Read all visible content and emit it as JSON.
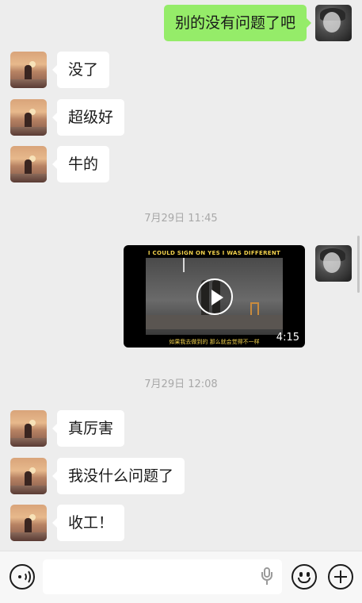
{
  "messages": [
    {
      "side": "right",
      "text": "别的没有问题了吧"
    },
    {
      "side": "left",
      "text": "没了"
    },
    {
      "side": "left",
      "text": "超级好"
    },
    {
      "side": "left",
      "text": "牛的"
    },
    {
      "side": "left",
      "text": "真厉害"
    },
    {
      "side": "left",
      "text": "我没什么问题了"
    },
    {
      "side": "left",
      "text": "收工！"
    }
  ],
  "timestamps": [
    "7月29日 11:45",
    "7月29日 12:08"
  ],
  "video": {
    "caption_top": "I COULD SIGN ON YES I WAS DIFFERENT",
    "caption_bottom": "如果我去做到的  那么就会觉得不一样",
    "duration": "4:15"
  },
  "input_bar": {
    "placeholder": "",
    "icons": [
      "voice-icon",
      "mic-icon",
      "emoji-icon",
      "plus-icon"
    ]
  },
  "colors": {
    "background": "#ededed",
    "sent_bubble": "#95ec69",
    "received_bubble": "#ffffff",
    "timestamp_text": "#a8a8a8"
  }
}
